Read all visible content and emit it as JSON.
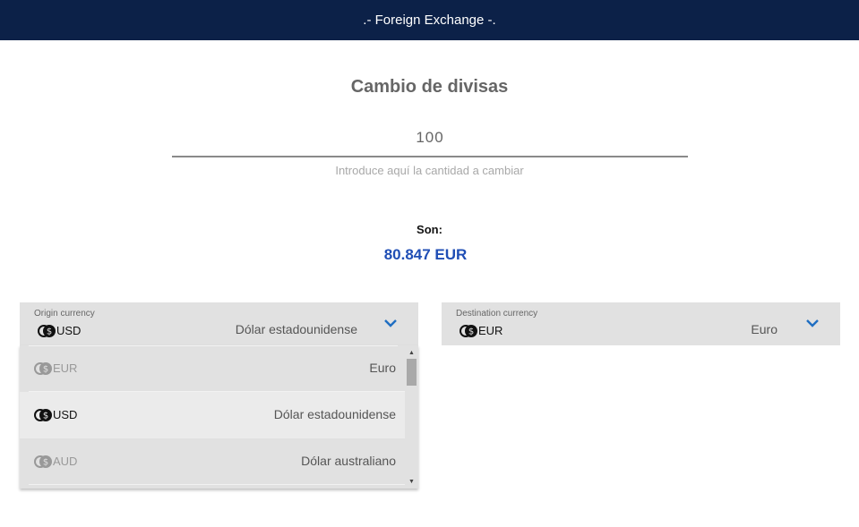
{
  "header": {
    "title": ".- Foreign Exchange -."
  },
  "converter": {
    "title": "Cambio de divisas",
    "amount_value": "100",
    "amount_helper": "Introduce aquí la cantidad a cambiar",
    "result_label": "Son:",
    "result_value": "80.847 EUR"
  },
  "origin": {
    "caption": "Origin currency",
    "code": "USD",
    "name": "Dólar estadounidense",
    "options": [
      {
        "code": "EUR",
        "name": "Euro"
      },
      {
        "code": "USD",
        "name": "Dólar estadounidense"
      },
      {
        "code": "AUD",
        "name": "Dólar australiano"
      }
    ]
  },
  "destination": {
    "caption": "Destination currency",
    "code": "EUR",
    "name": "Euro"
  },
  "colors": {
    "header_bg": "#0c2148",
    "accent": "#1f4eb5",
    "chevron": "#1f6ec2",
    "select_bg": "#e1e1e1"
  },
  "icons": {
    "currency": "coins-icon",
    "dropdown": "chevron-down-icon"
  }
}
